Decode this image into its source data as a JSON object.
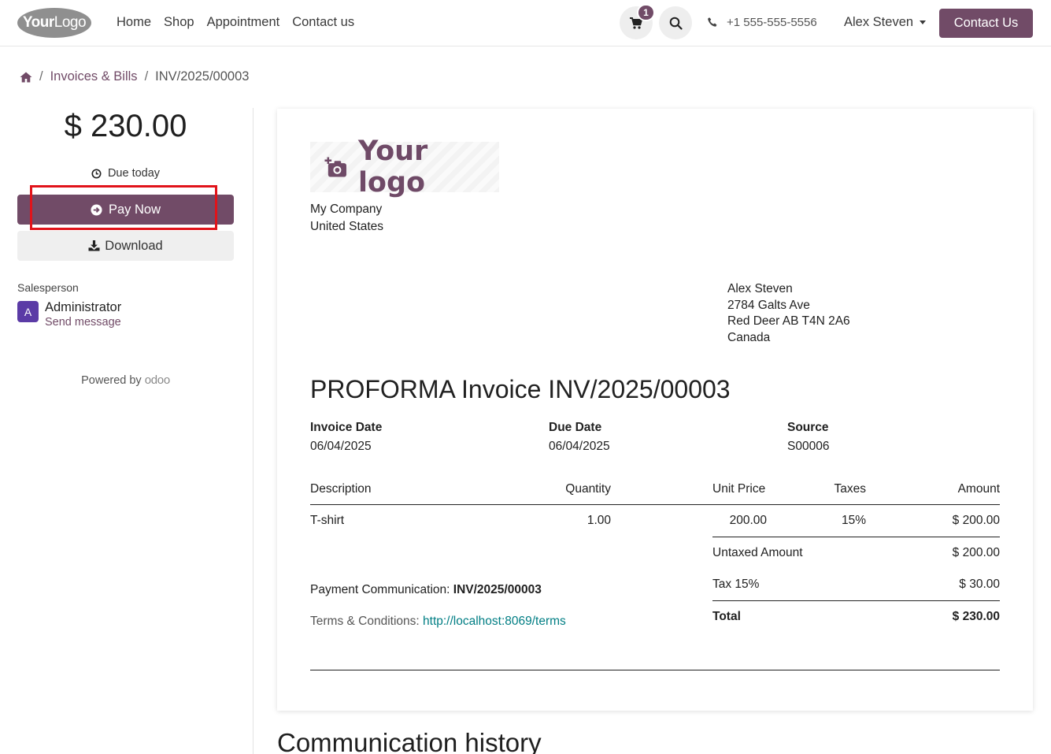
{
  "header": {
    "logo": {
      "bold": "Your",
      "light": "Logo"
    },
    "nav": [
      "Home",
      "Shop",
      "Appointment",
      "Contact us"
    ],
    "cart_count": "1",
    "phone": "+1 555-555-5556",
    "user": "Alex Steven",
    "contact_button": "Contact Us",
    "accent_color": "#714b67"
  },
  "breadcrumb": {
    "items": [
      "Invoices & Bills",
      "INV/2025/00003"
    ]
  },
  "sidebar": {
    "amount": "$ 230.00",
    "due": "Due today",
    "pay_button": "Pay Now",
    "download_button": "Download",
    "salesperson_label": "Salesperson",
    "avatar_initial": "A",
    "salesperson_name": "Administrator",
    "send_message": "Send message",
    "powered_by": "Powered by",
    "odoo": "odoo"
  },
  "invoice": {
    "logo_text": "Your logo",
    "company": [
      "My Company",
      "United States"
    ],
    "customer": [
      "Alex Steven",
      "2784 Galts Ave",
      "Red Deer AB T4N 2A6",
      "Canada"
    ],
    "title": "PROFORMA Invoice INV/2025/00003",
    "info": [
      {
        "label": "Invoice Date",
        "value": "06/04/2025"
      },
      {
        "label": "Due Date",
        "value": "06/04/2025"
      },
      {
        "label": "Source",
        "value": "S00006"
      }
    ],
    "columns": {
      "description": "Description",
      "quantity": "Quantity",
      "unit_price": "Unit Price",
      "taxes": "Taxes",
      "amount": "Amount"
    },
    "lines": [
      {
        "description": "T-shirt",
        "quantity": "1.00",
        "unit_price": "200.00",
        "taxes": "15%",
        "amount": "$ 200.00"
      }
    ],
    "untaxed_label": "Untaxed Amount",
    "untaxed_value": "$ 200.00",
    "tax_label": "Tax 15%",
    "tax_value": "$ 30.00",
    "total_label": "Total",
    "total_value": "$ 230.00",
    "payment_comm_label": "Payment Communication:",
    "payment_comm_value": "INV/2025/00003",
    "terms_label": "Terms & Conditions:",
    "terms_url": "http://localhost:8069/terms"
  },
  "communication_title": "Communication history"
}
